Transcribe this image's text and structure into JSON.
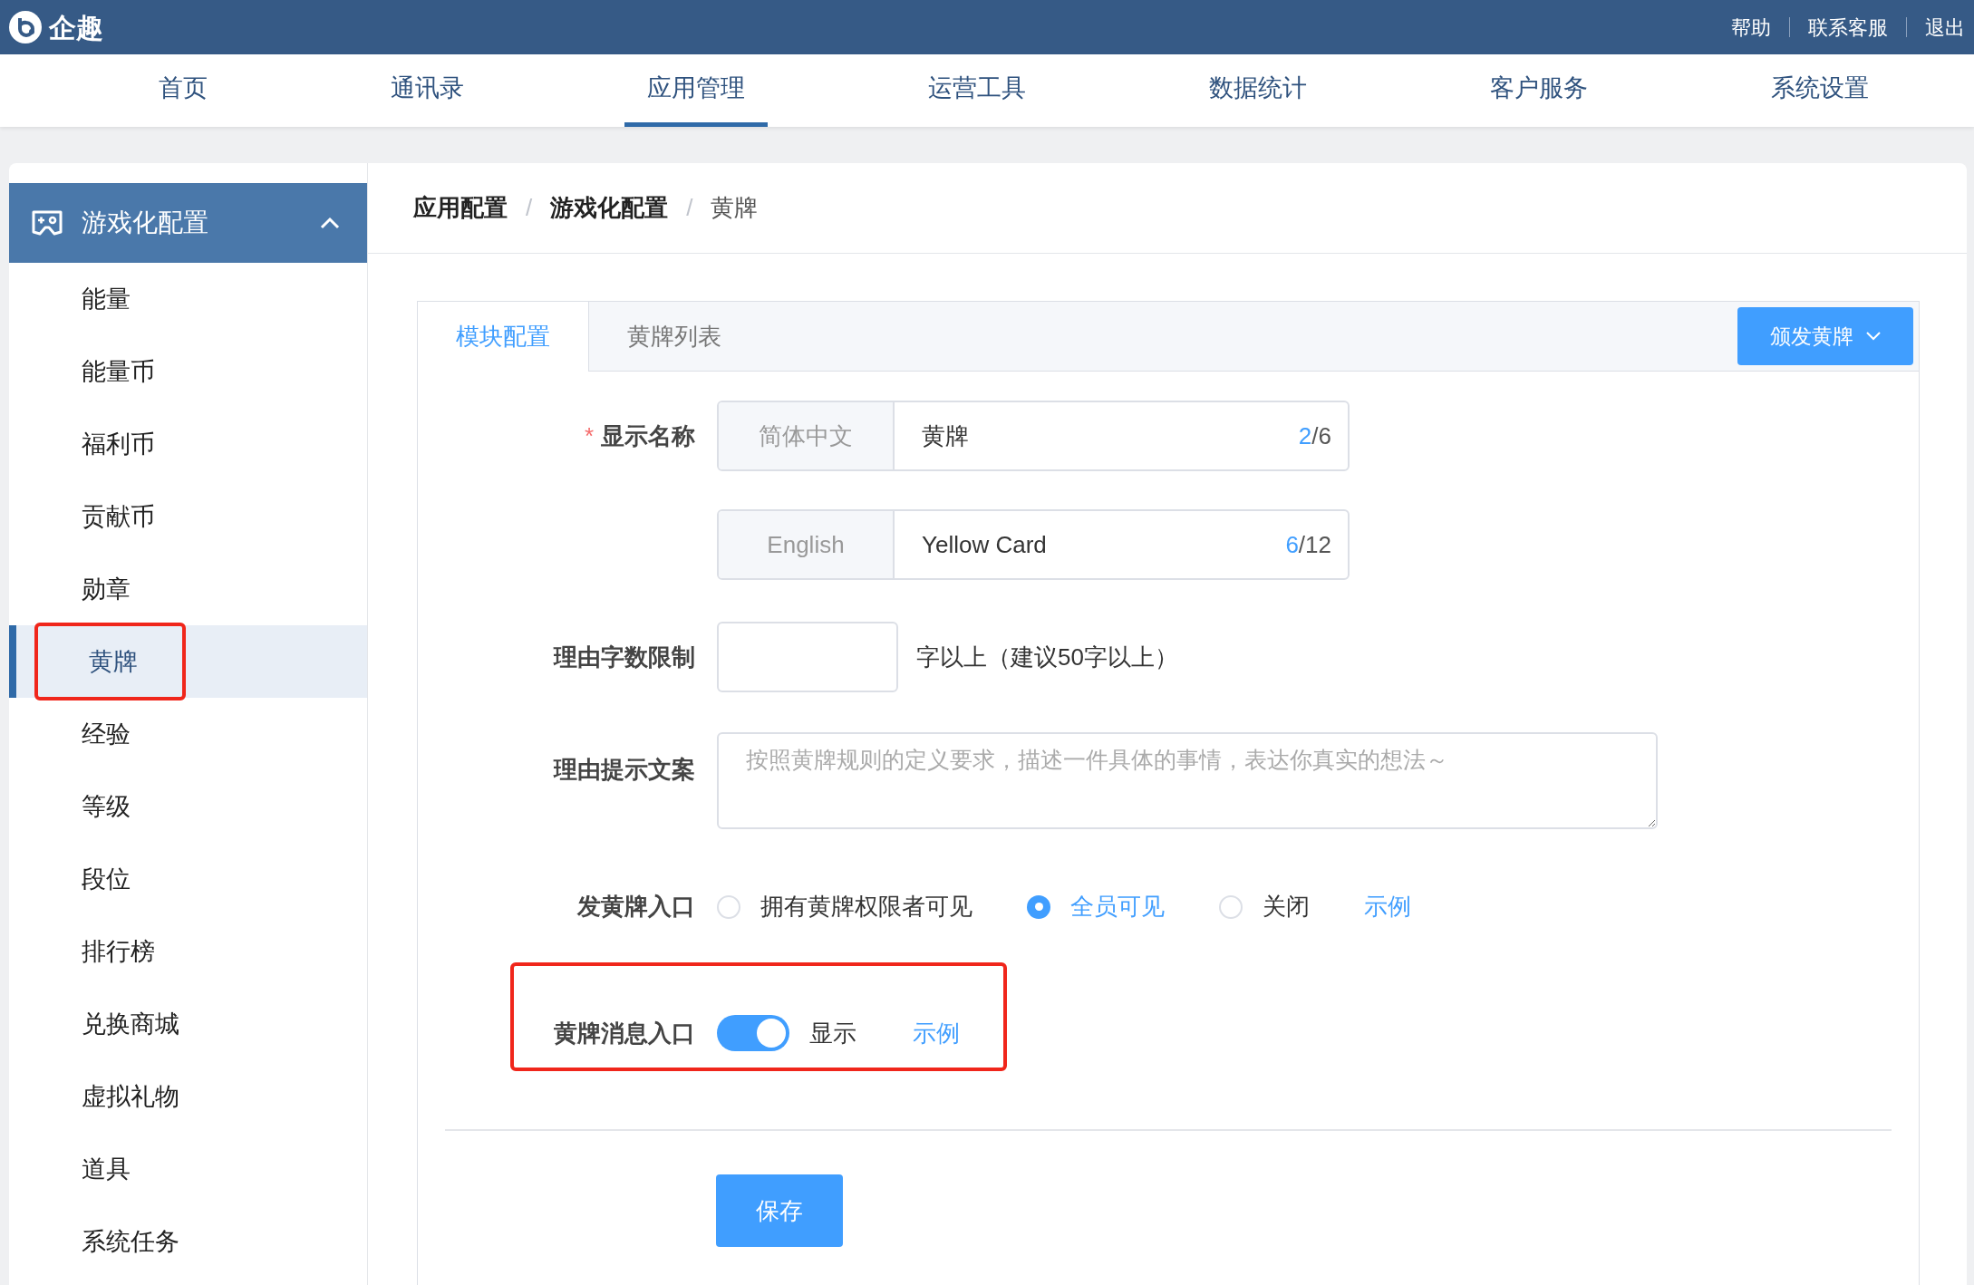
{
  "header": {
    "brand": "企趣",
    "links": [
      "帮助",
      "联系客服",
      "退出"
    ]
  },
  "nav": [
    {
      "label": "首页",
      "selected": false
    },
    {
      "label": "通讯录",
      "selected": false
    },
    {
      "label": "应用管理",
      "selected": true
    },
    {
      "label": "运营工具",
      "selected": false
    },
    {
      "label": "数据统计",
      "selected": false
    },
    {
      "label": "客户服务",
      "selected": false
    },
    {
      "label": "系统设置",
      "selected": false
    }
  ],
  "sidebar": {
    "group": {
      "label": "游戏化配置",
      "expanded": true
    },
    "items": [
      {
        "label": "能量",
        "selected": false,
        "highlighted": false
      },
      {
        "label": "能量币",
        "selected": false,
        "highlighted": false
      },
      {
        "label": "福利币",
        "selected": false,
        "highlighted": false
      },
      {
        "label": "贡献币",
        "selected": false,
        "highlighted": false
      },
      {
        "label": "勋章",
        "selected": false,
        "highlighted": false
      },
      {
        "label": "黄牌",
        "selected": true,
        "highlighted": true
      },
      {
        "label": "经验",
        "selected": false,
        "highlighted": false
      },
      {
        "label": "等级",
        "selected": false,
        "highlighted": false
      },
      {
        "label": "段位",
        "selected": false,
        "highlighted": false
      },
      {
        "label": "排行榜",
        "selected": false,
        "highlighted": false
      },
      {
        "label": "兑换商城",
        "selected": false,
        "highlighted": false
      },
      {
        "label": "虚拟礼物",
        "selected": false,
        "highlighted": false
      },
      {
        "label": "道具",
        "selected": false,
        "highlighted": false
      },
      {
        "label": "系统任务",
        "selected": false,
        "highlighted": false
      }
    ]
  },
  "breadcrumb": {
    "separator": "/",
    "items": [
      "应用配置",
      "游戏化配置",
      "黄牌"
    ]
  },
  "tabs": [
    {
      "label": "模块配置",
      "selected": true
    },
    {
      "label": "黄牌列表",
      "selected": false
    }
  ],
  "issue_button": "颁发黄牌",
  "form": {
    "display_name": {
      "label": "显示名称",
      "required_mark": "*",
      "fields": [
        {
          "prefix": "简体中文",
          "value": "黄牌",
          "count": "2",
          "limit": "/6"
        },
        {
          "prefix": "English",
          "value": "Yellow Card",
          "count": "6",
          "limit": "/12"
        }
      ]
    },
    "reason_limit": {
      "label": "理由字数限制",
      "suffix": "字以上（建议50字以上）"
    },
    "reason_hint": {
      "label": "理由提示文案",
      "placeholder": "按照黄牌规则的定义要求，描述一件具体的事情，表达你真实的想法～"
    },
    "issue_entry": {
      "label": "发黄牌入口",
      "options": [
        {
          "label": "拥有黄牌权限者可见",
          "selected": false
        },
        {
          "label": "全员可见",
          "selected": true
        },
        {
          "label": "关闭",
          "selected": false
        }
      ],
      "example": "示例"
    },
    "message_entry": {
      "label": "黄牌消息入口",
      "on": true,
      "state_label": "显示",
      "example": "示例",
      "highlighted": true
    },
    "save": "保存"
  }
}
